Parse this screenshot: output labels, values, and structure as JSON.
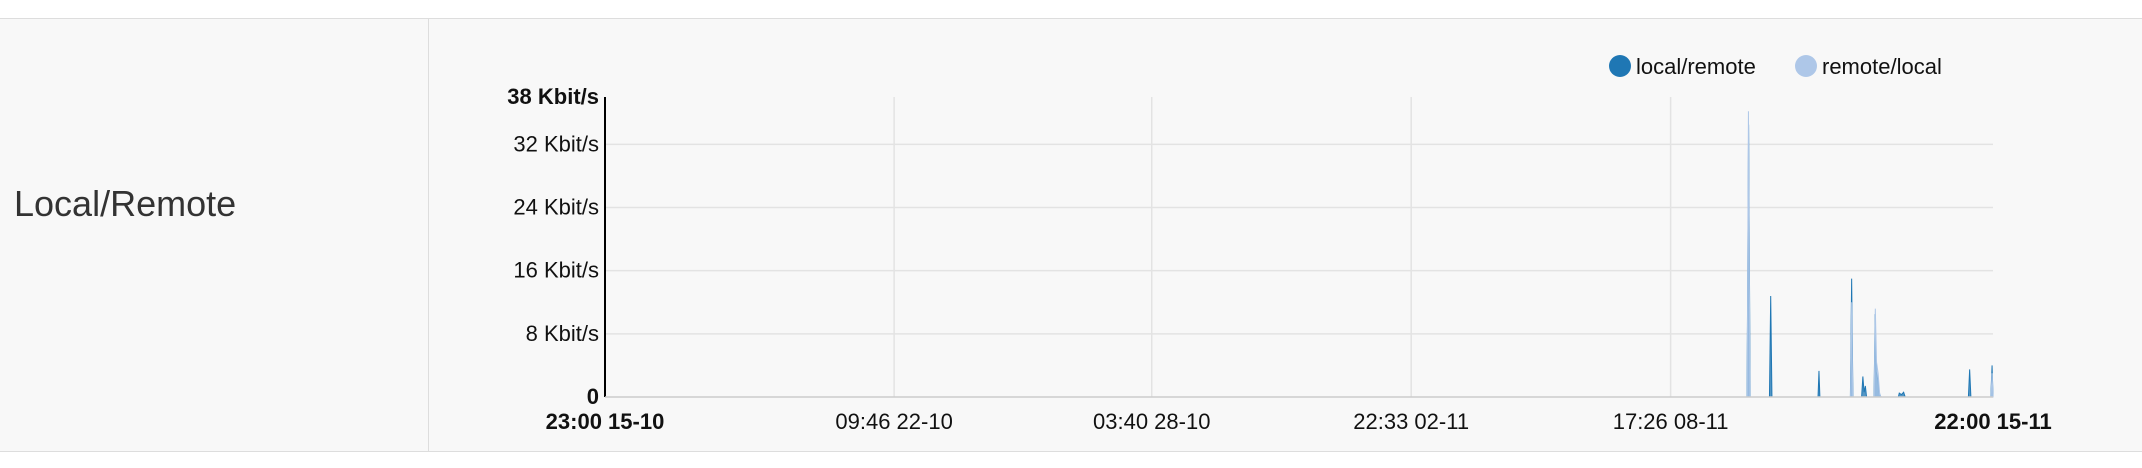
{
  "row": {
    "title": "Local/Remote"
  },
  "chart_data": {
    "type": "area",
    "title": "",
    "xlabel": "",
    "ylabel": "",
    "y_unit": "Kbit/s",
    "ylim": [
      0,
      38
    ],
    "y_ticks": [
      {
        "value": 0,
        "label": "0",
        "bold": true
      },
      {
        "value": 8,
        "label": "8 Kbit/s",
        "bold": false
      },
      {
        "value": 16,
        "label": "16 Kbit/s",
        "bold": false
      },
      {
        "value": 24,
        "label": "24 Kbit/s",
        "bold": false
      },
      {
        "value": 32,
        "label": "32 Kbit/s",
        "bold": false
      },
      {
        "value": 38,
        "label": "38 Kbit/s",
        "bold": true
      }
    ],
    "x_range": [
      "2023-10-15T23:00",
      "2023-11-15T22:00"
    ],
    "x_ticks": [
      {
        "value": "2023-10-15T23:00",
        "label": "23:00 15-10",
        "bold": true
      },
      {
        "value": "2023-10-22T09:46",
        "label": "09:46 22-10",
        "bold": false
      },
      {
        "value": "2023-10-28T03:40",
        "label": "03:40 28-10",
        "bold": false
      },
      {
        "value": "2023-11-02T22:33",
        "label": "22:33 02-11",
        "bold": false
      },
      {
        "value": "2023-11-08T17:26",
        "label": "17:26 08-11",
        "bold": false
      },
      {
        "value": "2023-11-15T22:00",
        "label": "22:00 15-11",
        "bold": true
      }
    ],
    "grid": true,
    "legend": "top-right",
    "series": [
      {
        "name": "local/remote",
        "color": "#1f77b4",
        "points": [
          [
            "2023-11-10T10:20",
            0
          ],
          [
            "2023-11-10T11:10",
            34.5
          ],
          [
            "2023-11-10T12:00",
            0
          ],
          [
            "2023-11-10T22:20",
            0
          ],
          [
            "2023-11-10T23:00",
            12.8
          ],
          [
            "2023-11-10T23:40",
            0
          ],
          [
            "2023-11-12T00:20",
            0
          ],
          [
            "2023-11-12T00:50",
            3.3
          ],
          [
            "2023-11-12T01:20",
            0
          ],
          [
            "2023-11-12T17:40",
            0
          ],
          [
            "2023-11-12T18:20",
            15.0
          ],
          [
            "2023-11-12T19:00",
            0
          ],
          [
            "2023-11-12T23:40",
            0
          ],
          [
            "2023-11-13T00:20",
            2.6
          ],
          [
            "2023-11-13T01:00",
            0.6
          ],
          [
            "2023-11-13T01:40",
            1.4
          ],
          [
            "2023-11-13T02:20",
            0
          ],
          [
            "2023-11-13T06:20",
            0
          ],
          [
            "2023-11-13T06:55",
            10.5
          ],
          [
            "2023-11-13T07:30",
            3.2
          ],
          [
            "2023-11-13T08:20",
            2.2
          ],
          [
            "2023-11-13T09:10",
            0.5
          ],
          [
            "2023-11-13T10:00",
            0
          ],
          [
            "2023-11-13T19:20",
            0
          ],
          [
            "2023-11-13T19:50",
            0.5
          ],
          [
            "2023-11-13T21:00",
            0.3
          ],
          [
            "2023-11-13T22:10",
            0.6
          ],
          [
            "2023-11-13T23:00",
            0
          ],
          [
            "2023-11-15T08:50",
            0
          ],
          [
            "2023-11-15T09:30",
            3.5
          ],
          [
            "2023-11-15T10:10",
            0
          ],
          [
            "2023-11-15T20:50",
            0
          ],
          [
            "2023-11-15T21:30",
            4.0
          ],
          [
            "2023-11-15T22:00",
            0
          ]
        ]
      },
      {
        "name": "remote/local",
        "color": "#aec7e8",
        "points": [
          [
            "2023-11-10T10:25",
            0
          ],
          [
            "2023-11-10T11:05",
            36.2
          ],
          [
            "2023-11-10T11:55",
            0
          ],
          [
            "2023-11-12T17:45",
            0
          ],
          [
            "2023-11-12T18:20",
            12.0
          ],
          [
            "2023-11-12T18:55",
            0
          ],
          [
            "2023-11-13T06:25",
            0
          ],
          [
            "2023-11-13T07:00",
            11.2
          ],
          [
            "2023-11-13T07:40",
            4.4
          ],
          [
            "2023-11-13T08:30",
            3.0
          ],
          [
            "2023-11-13T09:20",
            0.4
          ],
          [
            "2023-11-13T10:00",
            0
          ],
          [
            "2023-11-15T20:55",
            0
          ],
          [
            "2023-11-15T21:30",
            3.0
          ],
          [
            "2023-11-15T22:00",
            0
          ]
        ]
      }
    ]
  }
}
